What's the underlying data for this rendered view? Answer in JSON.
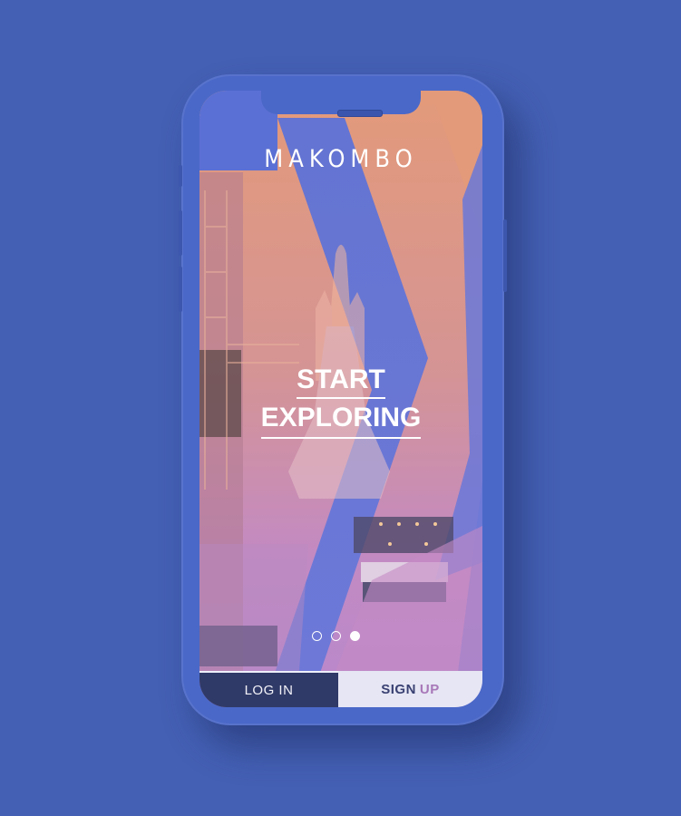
{
  "app": {
    "logo": "MAKOMBO",
    "headline_line1": "START",
    "headline_line2": "EXPLORING"
  },
  "pager": {
    "count": 3,
    "active_index": 2
  },
  "buttons": {
    "login_label": "LOG IN",
    "signup_label_1": "SIGN",
    "signup_label_2": "UP"
  },
  "colors": {
    "background": "#4460b4",
    "phone": "#4a68c8",
    "accent_orange": "#e09a7c",
    "accent_pink": "#c48ac4",
    "accent_blue": "#5b70d4"
  }
}
